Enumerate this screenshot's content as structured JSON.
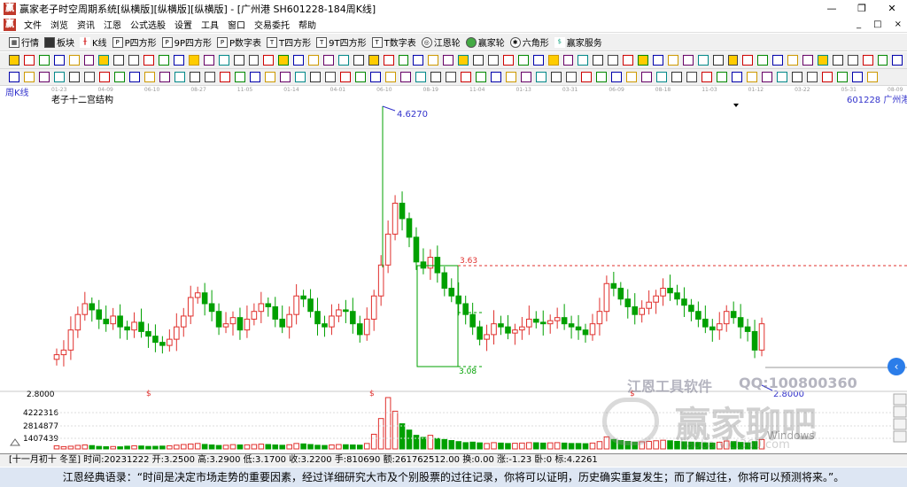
{
  "window": {
    "title": "赢家老子时空周期系统[纵横版][纵横版][纵横版] - [广州港  SH601228-184周K线]",
    "app_icon": "赢"
  },
  "menu": {
    "items": [
      "文件",
      "浏览",
      "资讯",
      "江恩",
      "公式选股",
      "设置",
      "工具",
      "窗口",
      "交易委托",
      "帮助"
    ],
    "right": [
      "_",
      "□",
      "×"
    ]
  },
  "toolbar1": {
    "items": [
      "行情",
      "板块",
      "K线",
      "P四方形",
      "9P四方形",
      "P数字表",
      "T四方形",
      "9T四方形",
      "T数字表",
      "江恩轮",
      "赢家轮",
      "六角形",
      "赢家服务"
    ]
  },
  "chart": {
    "period_label": "周K线",
    "formula_label": "老子十二宫结构",
    "stock_label": "601228  广州港",
    "x_ticks": [
      "01-23",
      "04-09",
      "06-10",
      "08-27",
      "11-05",
      "01-14",
      "04-01",
      "06-10",
      "08-19",
      "11-04",
      "01-13",
      "03-31",
      "06-09",
      "08-18",
      "11-03",
      "01-12",
      "03-22",
      "05-31",
      "08-09"
    ],
    "high_label": "4.6270",
    "low_label": "2.8000",
    "box_top": "3.63",
    "box_bottom": "3.08",
    "y_bottom": "2.8000",
    "vol_ticks": [
      "4222316",
      "2814877",
      "1407439"
    ],
    "dollar_mark": "$",
    "accent_up": "#e0302d",
    "accent_down": "#00a000",
    "line_blue": "#3333cc"
  },
  "chart_data": {
    "type": "candlestick",
    "title": "老子十二宫结构",
    "period": "周K线",
    "symbol": "601228",
    "name": "广州港",
    "price_range": [
      2.8,
      4.627
    ],
    "annotations": {
      "high": 4.627,
      "low": 2.8,
      "box_top": 3.63,
      "box_bottom": 3.08
    },
    "volume_ticks": [
      4222316,
      2814877,
      1407439
    ],
    "closes": [
      3.02,
      3.05,
      3.18,
      3.28,
      3.35,
      3.31,
      3.25,
      3.22,
      3.27,
      3.2,
      3.18,
      3.23,
      3.17,
      3.14,
      3.1,
      3.08,
      3.12,
      3.2,
      3.27,
      3.39,
      3.42,
      3.35,
      3.3,
      3.2,
      3.22,
      3.26,
      3.18,
      3.25,
      3.3,
      3.35,
      3.33,
      3.25,
      3.2,
      3.28,
      3.4,
      3.38,
      3.3,
      3.22,
      3.2,
      3.27,
      3.31,
      3.3,
      3.22,
      3.15,
      3.25,
      3.4,
      3.6,
      3.8,
      4.0,
      3.9,
      3.78,
      3.62,
      3.58,
      3.65,
      3.55,
      3.45,
      3.4,
      3.35,
      3.28,
      3.2,
      3.12,
      3.15,
      3.22,
      3.2,
      3.16,
      3.18,
      3.2,
      3.25,
      3.23,
      3.22,
      3.24,
      3.26,
      3.22,
      3.2,
      3.18,
      3.15,
      3.22,
      3.3,
      3.48,
      3.45,
      3.38,
      3.33,
      3.28,
      3.32,
      3.36,
      3.4,
      3.45,
      3.42,
      3.38,
      3.34,
      3.3,
      3.25,
      3.2,
      3.18,
      3.22,
      3.3,
      3.26,
      3.2,
      3.17,
      3.05,
      3.22
    ],
    "volumes": [
      300,
      220,
      260,
      340,
      380,
      320,
      240,
      210,
      230,
      200,
      260,
      300,
      280,
      240,
      250,
      270,
      300,
      360,
      420,
      470,
      520,
      430,
      380,
      330,
      350,
      410,
      380,
      390,
      420,
      460,
      420,
      380,
      350,
      400,
      520,
      480,
      420,
      350,
      330,
      380,
      420,
      400,
      380,
      360,
      520,
      1400,
      2900,
      4900,
      3600,
      2400,
      1800,
      1300,
      1100,
      1300,
      1000,
      900,
      800,
      700,
      600,
      650,
      580,
      520,
      600,
      560,
      520,
      540,
      560,
      600,
      590,
      560,
      580,
      600,
      560,
      520,
      520,
      500,
      560,
      700,
      1150,
      900,
      800,
      720,
      640,
      680,
      720,
      780,
      830,
      780,
      720,
      680,
      650,
      620,
      580,
      560,
      640,
      760,
      700,
      620,
      580,
      700,
      900
    ]
  },
  "status": {
    "text": "[十一月初十 冬至] 时间:20231222 开:3.2500 高:3.2900 低:3.1700 收:3.2200 手:810690 额:261762512.00 换:0.00 涨:-1.23 卧:0 标:4.2261"
  },
  "quote": {
    "text": "江恩经典语录：“时间是决定市场走势的重要因素，经过详细研究大市及个别股票的过往记录，你将可以证明，历史确实重复发生；而了解过往，你将可以预测将来。”。"
  },
  "watermark": {
    "brand": "江恩工具软件",
    "qq": "QQ:100800360",
    "name": "赢家聊吧",
    "site": "liaoba.vict360.com",
    "windows": "Windows"
  }
}
